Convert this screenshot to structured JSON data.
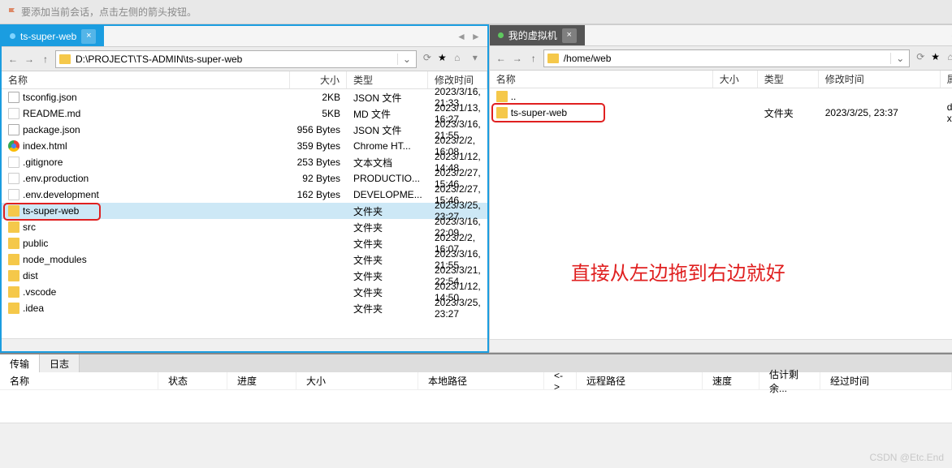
{
  "hint": "要添加当前会话，点击左侧的箭头按钮。",
  "tabs": {
    "left": "ts-super-web",
    "right": "我的虚拟机"
  },
  "paths": {
    "left": "D:\\PROJECT\\TS-ADMIN\\ts-super-web",
    "right": "/home/web"
  },
  "columns_left": {
    "name": "名称",
    "size": "大小",
    "type": "类型",
    "date": "修改时间"
  },
  "columns_right": {
    "name": "名称",
    "size": "大小",
    "type": "类型",
    "date": "修改时间",
    "attr": "属性"
  },
  "files_left": [
    {
      "icon": "ico-json",
      "name": "tsconfig.json",
      "size": "2KB",
      "type": "JSON 文件",
      "date": "2023/3/16, 21:33"
    },
    {
      "icon": "ico-txt",
      "name": "README.md",
      "size": "5KB",
      "type": "MD 文件",
      "date": "2023/1/13, 16:27"
    },
    {
      "icon": "ico-json",
      "name": "package.json",
      "size": "956 Bytes",
      "type": "JSON 文件",
      "date": "2023/3/16, 21:55"
    },
    {
      "icon": "ico-chrome",
      "name": "index.html",
      "size": "359 Bytes",
      "type": "Chrome HT...",
      "date": "2023/2/2, 16:08"
    },
    {
      "icon": "ico-txt",
      "name": ".gitignore",
      "size": "253 Bytes",
      "type": "文本文档",
      "date": "2023/1/12, 14:48"
    },
    {
      "icon": "ico-txt",
      "name": ".env.production",
      "size": "92 Bytes",
      "type": "PRODUCTIO...",
      "date": "2023/2/27, 15:46"
    },
    {
      "icon": "ico-txt",
      "name": ".env.development",
      "size": "162 Bytes",
      "type": "DEVELOPME...",
      "date": "2023/2/27, 15:46"
    },
    {
      "icon": "ico-folder",
      "name": "ts-super-web",
      "size": "",
      "type": "文件夹",
      "date": "2023/3/25, 23:27",
      "sel": true
    },
    {
      "icon": "ico-folder",
      "name": "src",
      "size": "",
      "type": "文件夹",
      "date": "2023/3/16, 22:09"
    },
    {
      "icon": "ico-folder",
      "name": "public",
      "size": "",
      "type": "文件夹",
      "date": "2023/2/2, 16:07"
    },
    {
      "icon": "ico-folder",
      "name": "node_modules",
      "size": "",
      "type": "文件夹",
      "date": "2023/3/16, 21:55"
    },
    {
      "icon": "ico-folder",
      "name": "dist",
      "size": "",
      "type": "文件夹",
      "date": "2023/3/21, 22:54"
    },
    {
      "icon": "ico-folder",
      "name": ".vscode",
      "size": "",
      "type": "文件夹",
      "date": "2023/1/12, 14:50"
    },
    {
      "icon": "ico-folder",
      "name": ".idea",
      "size": "",
      "type": "文件夹",
      "date": "2023/3/25, 23:27"
    }
  ],
  "files_right": [
    {
      "icon": "ico-folder",
      "name": "..",
      "size": "",
      "type": "",
      "date": "",
      "attr": ""
    },
    {
      "icon": "ico-folder",
      "name": "ts-super-web",
      "size": "",
      "type": "文件夹",
      "date": "2023/3/25, 23:37",
      "attr": "drwxr-xr-x"
    }
  ],
  "annotation": "直接从左边拖到右边就好",
  "log": {
    "tabs": [
      "传输",
      "日志"
    ],
    "cols": {
      "name": "名称",
      "status": "状态",
      "progress": "进度",
      "size": "大小",
      "local": "本地路径",
      "dir": "<->",
      "remote": "远程路径",
      "speed": "速度",
      "est": "估计剩余...",
      "elapsed": "经过时间"
    }
  },
  "watermark": "CSDN @Etc.End"
}
